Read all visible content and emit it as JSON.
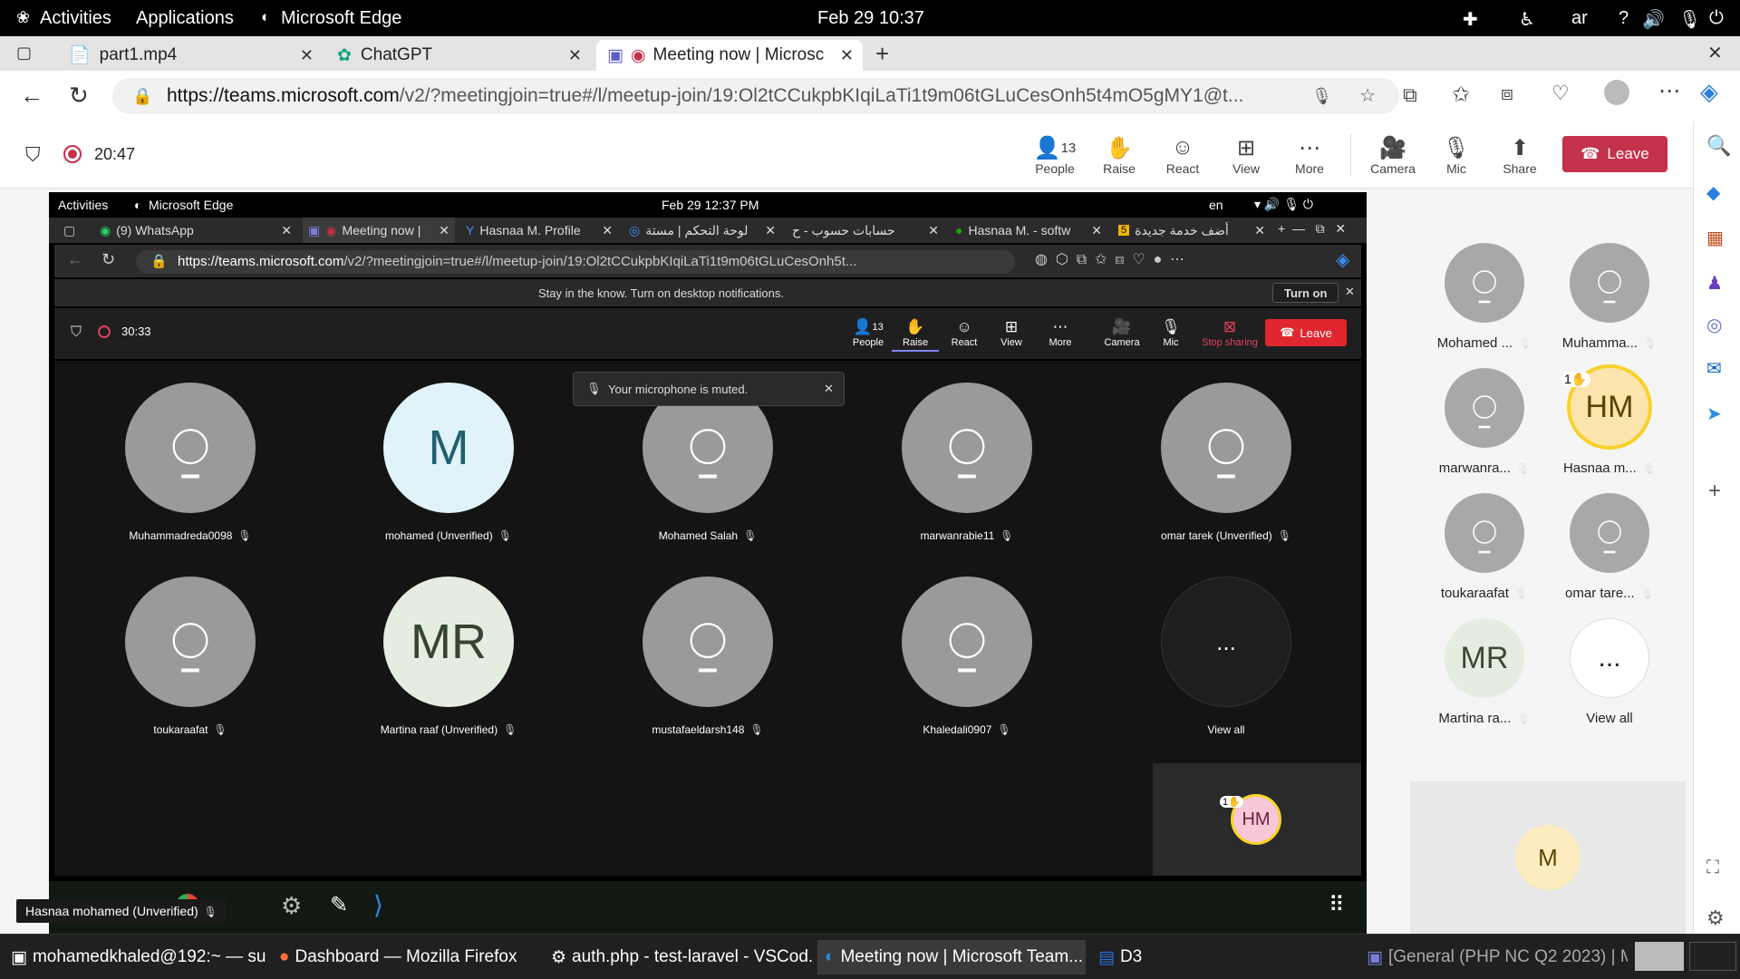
{
  "gnome": {
    "activities": "Activities",
    "applications": "Applications",
    "app": "Microsoft Edge",
    "datetime": "Feb 29  10:37",
    "lang": "ar"
  },
  "browser": {
    "tabs": [
      {
        "title": "part1.mp4"
      },
      {
        "title": "ChatGPT"
      },
      {
        "title": "Meeting now | Microsc"
      }
    ],
    "url_host": "https://teams.microsoft.com",
    "url_rest": "/v2/?meetingjoin=true#/l/meetup-join/19:Ol2tCCukpbKIqiLaTi1t9m06tGLuCesOnh5t4mO5gMY1@t..."
  },
  "meeting": {
    "timer": "20:47",
    "people_count": "13",
    "buttons": {
      "people": "People",
      "raise": "Raise",
      "react": "React",
      "view": "View",
      "more": "More",
      "camera": "Camera",
      "mic": "Mic",
      "share": "Share",
      "leave": "Leave"
    }
  },
  "panel": {
    "people": [
      {
        "name": "Mohamed ...",
        "initials": ""
      },
      {
        "name": "Muhamma...",
        "initials": ""
      },
      {
        "name": "marwanra...",
        "initials": ""
      },
      {
        "name": "Hasnaa m...",
        "initials": "HM",
        "raised": "1"
      },
      {
        "name": "toukaraafat",
        "initials": ""
      },
      {
        "name": "omar tare...",
        "initials": ""
      },
      {
        "name": "Martina ra...",
        "initials": "MR"
      },
      {
        "name": "View all",
        "initials": "..."
      }
    ],
    "self_initial": "M"
  },
  "shared": {
    "top": {
      "activities": "Activities",
      "app": "Microsoft Edge",
      "datetime": "Feb 29  12:37 PM",
      "lang": "en"
    },
    "tabs": [
      {
        "title": "(9) WhatsApp"
      },
      {
        "title": "Meeting now |"
      },
      {
        "title": "Hasnaa M. Profile"
      },
      {
        "title": "لوحة التحكم | مستة"
      },
      {
        "title": "حسابات حسوب - ح"
      },
      {
        "title": "Hasnaa M. - softw"
      },
      {
        "title": "أضف خدمة جديدة"
      }
    ],
    "url_host": "https://teams.microsoft.com",
    "url_rest": "/v2/?meetingjoin=true#/l/meetup-join/19:Ol2tCCukpbKIqiLaTi1t9m06tGLuCesOnh5t...",
    "notification": "Stay in the know. Turn on desktop notifications.",
    "turn_on": "Turn on",
    "timer": "30:33",
    "people_count": "13",
    "buttons": {
      "people": "People",
      "raise": "Raise",
      "react": "React",
      "view": "View",
      "more": "More",
      "camera": "Camera",
      "mic": "Mic",
      "stop": "Stop sharing",
      "leave": "Leave"
    },
    "toast": "Your microphone is muted.",
    "grid": [
      {
        "name": "Muhammadreda0098",
        "initials": ""
      },
      {
        "name": "mohamed (Unverified)",
        "initials": "M"
      },
      {
        "name": "Mohamed Salah",
        "initials": ""
      },
      {
        "name": "marwanrabie11",
        "initials": ""
      },
      {
        "name": "omar tarek (Unverified)",
        "initials": ""
      },
      {
        "name": "toukaraafat",
        "initials": ""
      },
      {
        "name": "Martina raaf (Unverified)",
        "initials": "MR"
      },
      {
        "name": "mustafaeldarsh148",
        "initials": ""
      },
      {
        "name": "Khaledali0907",
        "initials": ""
      },
      {
        "name": "View all",
        "initials": "..."
      }
    ],
    "self": {
      "initials": "HM",
      "raised": "1"
    },
    "dock_label": "Hasnaa mohamed (Unverified)"
  },
  "taskbar": [
    {
      "title": "mohamedkhaled@192:~ — su..."
    },
    {
      "title": "Dashboard — Mozilla Firefox"
    },
    {
      "title": "auth.php - test-laravel - VSCod..."
    },
    {
      "title": "Meeting now | Microsoft Team..."
    },
    {
      "title": "D3"
    },
    {
      "title": "[General (PHP NC Q2 2023) | Mi..."
    }
  ],
  "colors": {
    "leave": "#c4314b",
    "raise_yellow": "#f8d22a",
    "avatar_m_bg": "#dff3f8",
    "avatar_mr_bg": "#e5ede0"
  }
}
